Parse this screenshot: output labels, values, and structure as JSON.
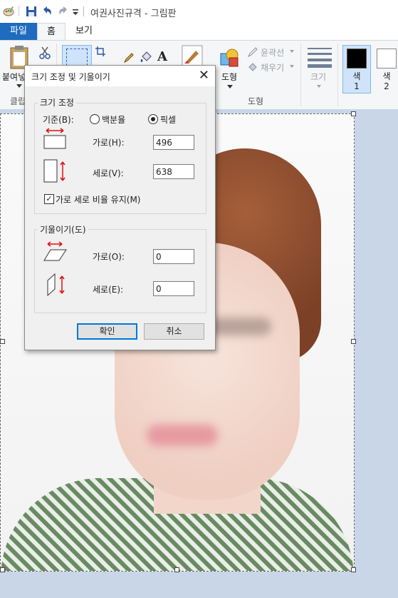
{
  "window": {
    "title": "여권사진규격 - 그림판"
  },
  "tabs": [
    {
      "label": "파일"
    },
    {
      "label": "홈"
    },
    {
      "label": "보기"
    }
  ],
  "ribbon": {
    "paste_label": "붙여넣",
    "clipboard_group": "클립",
    "shapes_label": "도형",
    "shapes_group": "도형",
    "outline_label": "윤곽선",
    "fill_label": "채우기",
    "size_label": "크기",
    "color1_label": "색\n1",
    "color1_line1": "색",
    "color1_line2": "1",
    "color2_line1": "색",
    "color2_line2": "2",
    "color1": "#000000",
    "color2": "#ffffff",
    "accent": "#1e6bbf"
  },
  "dialog": {
    "title": "크기 조정 및 기울이기",
    "resize": {
      "legend": "크기 조정",
      "basis_label": "기준(B):",
      "percent_label": "백분율",
      "pixel_label": "픽셀",
      "selected": "픽셀",
      "horizontal_label": "가로(H):",
      "horizontal_value": "496",
      "vertical_label": "세로(V):",
      "vertical_value": "638",
      "keep_ratio_label": "가로 세로 비율 유지(M)",
      "keep_ratio_checked": true
    },
    "skew": {
      "legend": "기울이기(도)",
      "horizontal_label": "가로(O):",
      "horizontal_value": "0",
      "vertical_label": "세로(E):",
      "vertical_value": "0"
    },
    "ok_label": "확인",
    "cancel_label": "취소"
  }
}
